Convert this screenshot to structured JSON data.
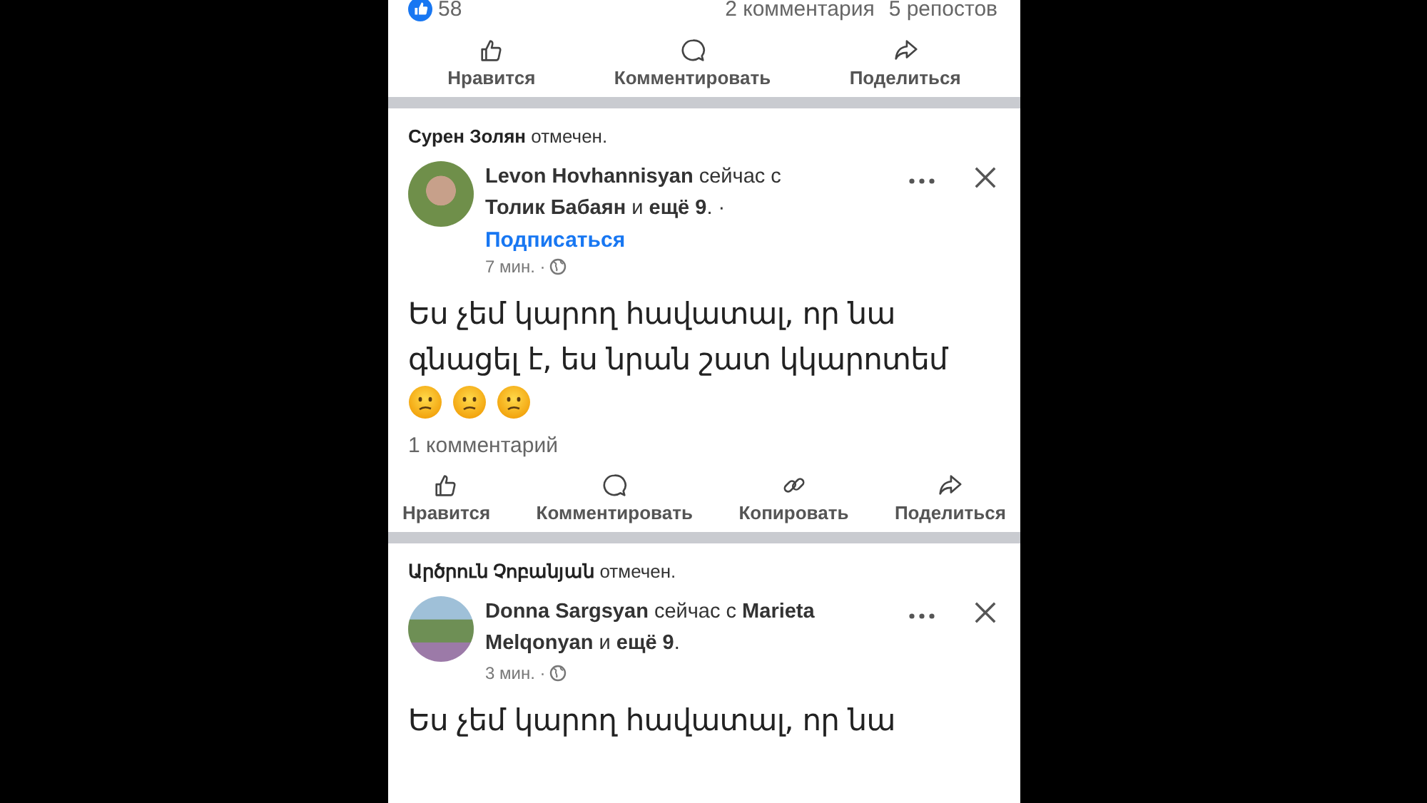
{
  "top_post": {
    "likes": "58",
    "comments": "2 комментария",
    "reposts": "5 репостов",
    "actions": [
      {
        "kind": "like",
        "label": "Нравится"
      },
      {
        "kind": "comment",
        "label": "Комментировать"
      },
      {
        "kind": "share",
        "label": "Поделиться"
      }
    ]
  },
  "posts": [
    {
      "tagged_name": "Сурен Золян",
      "tagged_suffix": "отмечен.",
      "author_line": "**Levon Hovhannisyan** сейчас с **Толик Бабаян** и **ещё 9**. ·",
      "follow": "Подписаться",
      "time": "7 мин. ·",
      "text": "Ես չեմ կարող հավատալ, որ նա գնացել է, ես նրան շատ կկարոտեմ",
      "emoji": true,
      "comments": "1 комментарий",
      "actions": [
        {
          "kind": "like",
          "label": "Нравится"
        },
        {
          "kind": "comment",
          "label": "Комментировать"
        },
        {
          "kind": "copy",
          "label": "Копировать"
        },
        {
          "kind": "share",
          "label": "Поделиться"
        }
      ]
    },
    {
      "tagged_name": "Արծրուն Չոբանյան",
      "tagged_suffix": "отмечен.",
      "author_line": "**Donna Sargsyan** сейчас с **Marieta Melqonyan** и **ещё 9**.",
      "time": "3 мин. ·",
      "text": "Ես չեմ կարող հավատալ, որ նա",
      "emoji": false
    }
  ]
}
